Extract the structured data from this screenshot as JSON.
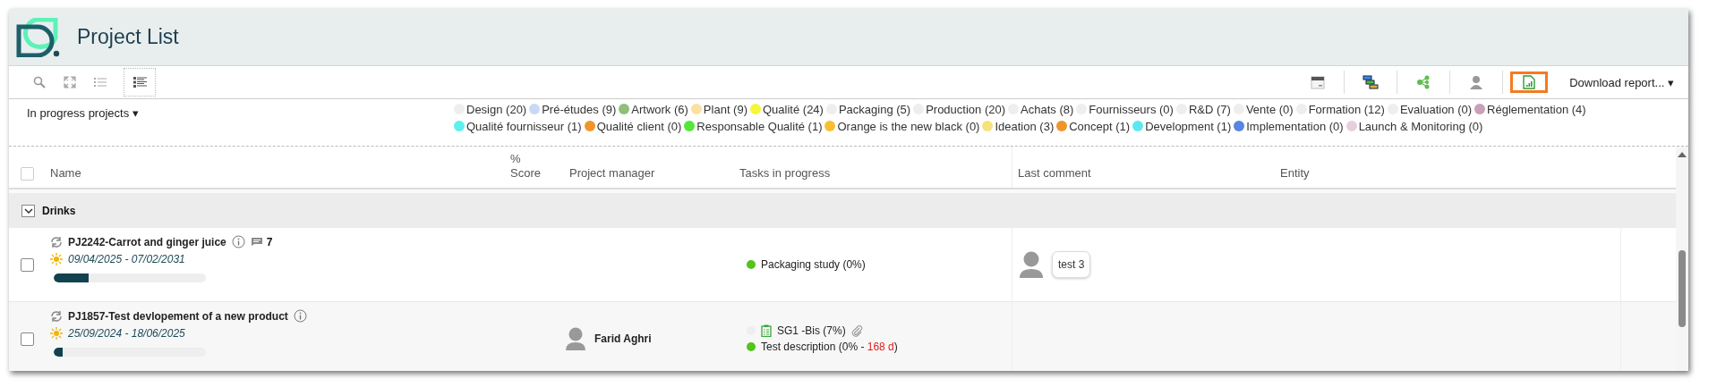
{
  "title": "Project List",
  "toolbar_left": [
    {
      "kind": "search",
      "selected": false
    },
    {
      "kind": "expand",
      "selected": false
    },
    {
      "kind": "list",
      "selected": false
    },
    {
      "kind": "detail",
      "selected": true
    }
  ],
  "toolbar_right": [
    {
      "kind": "calendar",
      "selected": false
    },
    {
      "kind": "gantt",
      "selected": false
    },
    {
      "kind": "network",
      "selected": false
    },
    {
      "kind": "user",
      "selected": false
    },
    {
      "kind": "report",
      "selected": true
    }
  ],
  "download": "Download report... ▾",
  "filter": "In progress projects ▾",
  "legend": [
    {
      "label": "Design (20)",
      "color": "#eeeeee"
    },
    {
      "label": "Pré-études (9)",
      "color": "#c9d8f5"
    },
    {
      "label": "Artwork (6)",
      "color": "#8fbf7a"
    },
    {
      "label": "Plant (9)",
      "color": "#fbe0a0"
    },
    {
      "label": "Qualité (24)",
      "color": "#f6f63a"
    },
    {
      "label": "Packaging (5)",
      "color": "#eeeeee"
    },
    {
      "label": "Production (20)",
      "color": "#eeeeee"
    },
    {
      "label": "Achats (8)",
      "color": "#eeeeee"
    },
    {
      "label": "Fournisseurs (0)",
      "color": "#eeeeee"
    },
    {
      "label": "R&D (7)",
      "color": "#eeeeee"
    },
    {
      "label": "Vente (0)",
      "color": "#eeeeee"
    },
    {
      "label": "Formation (12)",
      "color": "#eeeeee"
    },
    {
      "label": "Evaluation (0)",
      "color": "#eeeeee"
    },
    {
      "label": "Réglementation (4)",
      "color": "#c9a0b8"
    },
    {
      "label": "Qualité fournisseur (1)",
      "color": "#5cf0f0"
    },
    {
      "label": "Qualité client (0)",
      "color": "#f0952a"
    },
    {
      "label": "Responsable Qualité (1)",
      "color": "#55e63a"
    },
    {
      "label": "Orange is the new black (0)",
      "color": "#f8c030"
    },
    {
      "label": "Ideation (3)",
      "color": "#f6e27a"
    },
    {
      "label": "Concept (1)",
      "color": "#f0952a"
    },
    {
      "label": "Development (1)",
      "color": "#5ce8f0"
    },
    {
      "label": "Implementation (0)",
      "color": "#5a85e0"
    },
    {
      "label": "Launch & Monitoring (0)",
      "color": "#e6cfdc"
    }
  ],
  "table": {
    "select_all_checked": false,
    "columns": {
      "name": "Name",
      "score_1": "%",
      "score_2": "Score",
      "manager": "Project manager",
      "tasks": "Tasks in progress",
      "comment": "Last comment",
      "entity": "Entity"
    },
    "group": {
      "label": "Drinks",
      "expanded": true
    },
    "rows": [
      {
        "checked": false,
        "name": "PJ2242-Carrot and ginger juice",
        "comments": "7",
        "dates": "09/04/2025 - 07/02/2031",
        "level": 0.23,
        "tasks": [
          {
            "kind": "task",
            "color": "#52c41a",
            "text": "Packaging study (0%)"
          }
        ],
        "last_comment": "test 3"
      },
      {
        "checked": false,
        "name": "PJ1857-Test devlopement of a new product",
        "dates": "25/09/2024 - 18/06/2025",
        "level": 0.06,
        "manager": "Farid Aghri",
        "tasks": [
          {
            "kind": "deliverable",
            "color": "#eeeeee",
            "text": "SG1 -Bis (7%)"
          },
          {
            "kind": "task",
            "color": "#52c41a",
            "text": "Test description (0% - ",
            "late": "168 d",
            "text_end": ")"
          }
        ]
      }
    ]
  }
}
